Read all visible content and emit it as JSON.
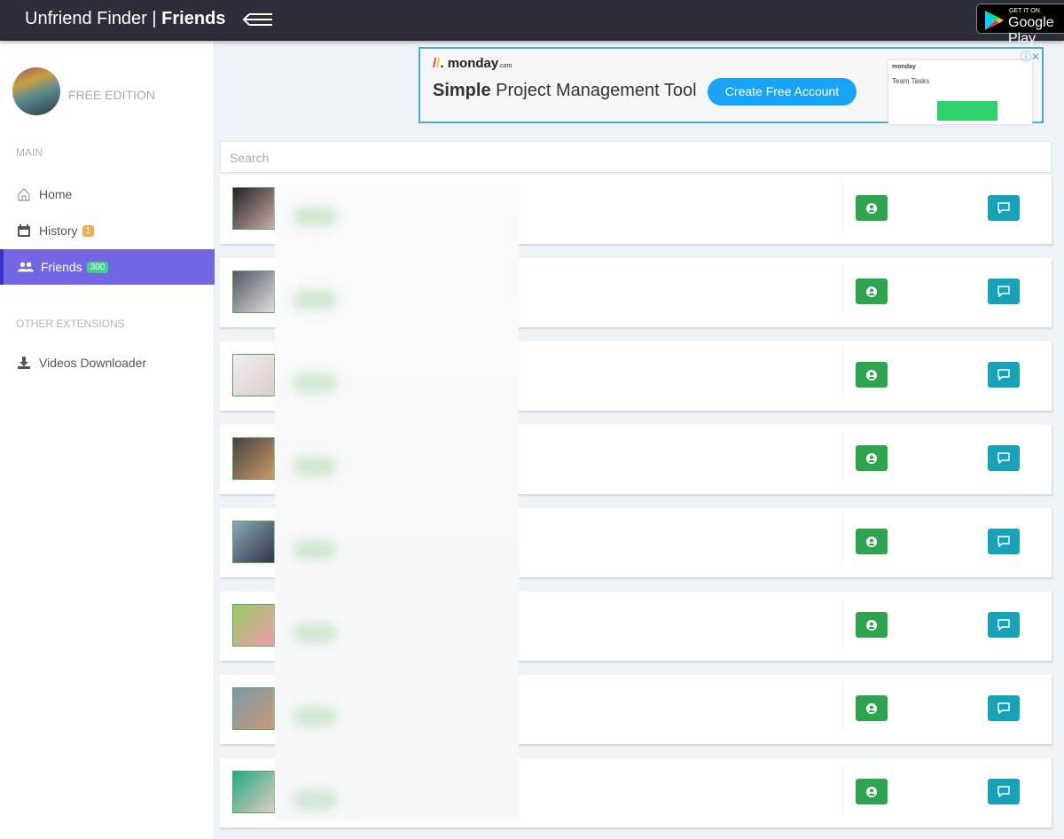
{
  "header": {
    "app_name": "Unfriend Finder",
    "separator": "|",
    "page": "Friends",
    "store_badge_small": "GET IT ON",
    "store_badge_big": "Google Play"
  },
  "sidebar": {
    "edition": "FREE EDITION",
    "main_label": "MAIN",
    "other_label": "OTHER EXTENSIONS",
    "items": [
      {
        "label": "Home",
        "icon": "home-icon"
      },
      {
        "label": "History",
        "icon": "calendar-icon",
        "badge": "1",
        "badge_color": "#f0ad4e"
      },
      {
        "label": "Friends",
        "icon": "users-icon",
        "badge": "300",
        "badge_color": "#3dd18c",
        "active": true
      }
    ],
    "extensions": [
      {
        "label": "Videos Downloader",
        "icon": "download-icon"
      }
    ]
  },
  "ad": {
    "brand": "monday",
    "brand_suffix": ".com",
    "headline_bold": "Simple",
    "headline": " Project Management Tool",
    "cta": "Create Free Account",
    "mock_title": "Team Tasks",
    "mock_brand": "monday"
  },
  "search": {
    "placeholder": "Search"
  },
  "friends": {
    "count_visible": 8,
    "profile_button_color": "#2ea44f",
    "message_button_color": "#17a2b8"
  },
  "colors": {
    "accent": "#7366e3",
    "topbar": "#2c2e3a"
  }
}
